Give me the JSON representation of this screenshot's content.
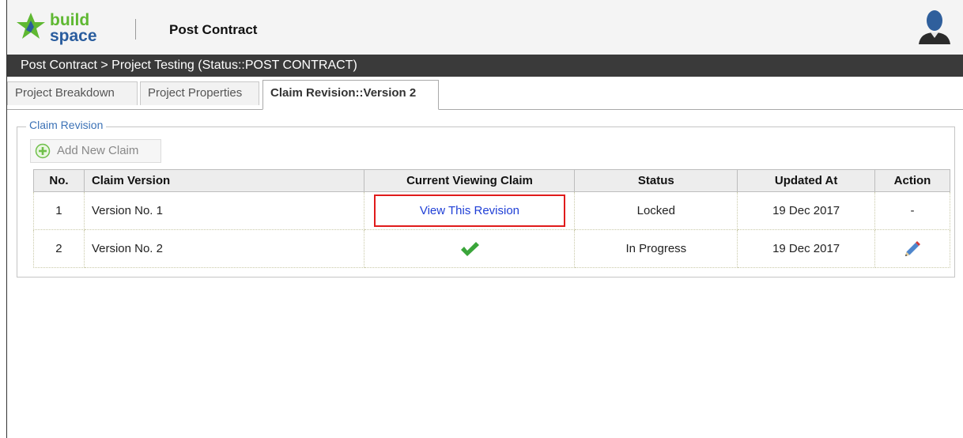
{
  "header": {
    "logo_text_top": "build",
    "logo_text_bottom": "space",
    "app_title": "Post Contract"
  },
  "breadcrumb": "Post Contract > Project Testing (Status::POST CONTRACT)",
  "tabs": [
    {
      "label": "Project Breakdown",
      "active": false
    },
    {
      "label": "Project Properties",
      "active": false
    },
    {
      "label": "Claim Revision::Version 2",
      "active": true
    }
  ],
  "claim_revision": {
    "legend": "Claim Revision",
    "add_button_label": "Add New Claim",
    "columns": [
      "No.",
      "Claim Version",
      "Current Viewing Claim",
      "Status",
      "Updated At",
      "Action"
    ],
    "rows": [
      {
        "no": "1",
        "version": "Version No. 1",
        "viewing": "View This Revision",
        "status": "Locked",
        "updated_at": "19 Dec 2017",
        "action": "-"
      },
      {
        "no": "2",
        "version": "Version No. 2",
        "viewing_icon": "check-icon",
        "status": "In Progress",
        "updated_at": "19 Dec 2017",
        "action_icon": "pencil-icon"
      }
    ]
  },
  "colors": {
    "breadcrumb_bg": "#3a3a3a",
    "link": "#1f3fd6",
    "highlight_border": "#e01b1b",
    "check": "#3aa53a",
    "logo_green": "#5fb832"
  }
}
